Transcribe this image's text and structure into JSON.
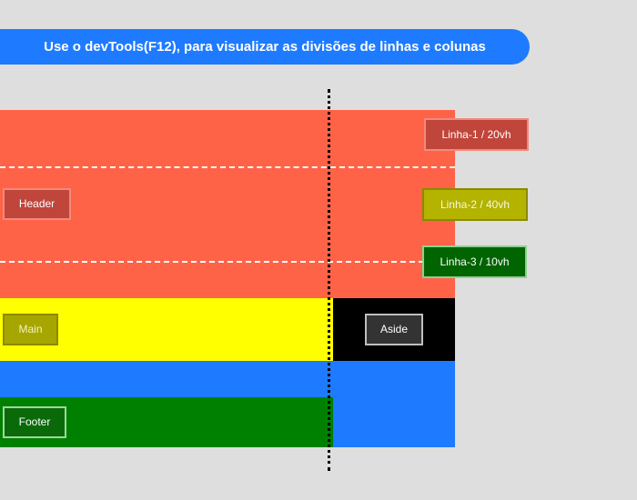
{
  "banner": {
    "text": "Use o devTools(F12), para visualizar as divisões de linhas e colunas"
  },
  "areas": {
    "header": "Header",
    "main": "Main",
    "aside": "Aside",
    "footer": "Footer"
  },
  "rows": [
    {
      "label": "Linha-1 / 20vh"
    },
    {
      "label": "Linha-2 / 40vh"
    },
    {
      "label": "Linha-3 / 10vh"
    }
  ],
  "colors": {
    "header": "#ff6347",
    "main": "#ffff00",
    "aside": "#000000",
    "footer": "#008000",
    "background_blue": "#1e7bff",
    "page": "#dedede"
  }
}
